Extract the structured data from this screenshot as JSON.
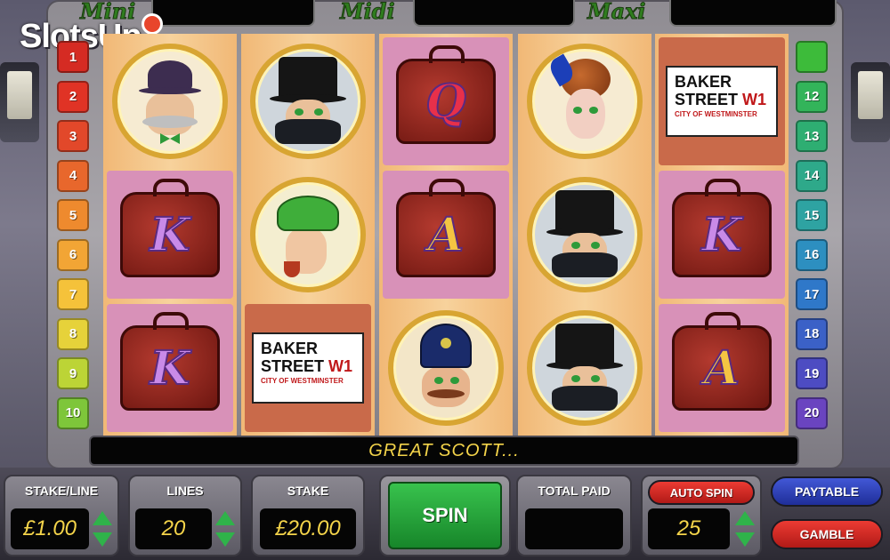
{
  "jackpots": [
    {
      "label": "Mini",
      "value": ""
    },
    {
      "label": "Midi",
      "value": ""
    },
    {
      "label": "Maxi",
      "value": ""
    }
  ],
  "logo": {
    "text_a": "Slots",
    "text_b": "Up"
  },
  "paylines": {
    "left": [
      {
        "n": "1",
        "color": "#d52b23"
      },
      {
        "n": "2",
        "color": "#e03325"
      },
      {
        "n": "3",
        "color": "#e2482a"
      },
      {
        "n": "4",
        "color": "#e8672c"
      },
      {
        "n": "5",
        "color": "#ee8a2e"
      },
      {
        "n": "6",
        "color": "#f2a535"
      },
      {
        "n": "7",
        "color": "#f5c23a"
      },
      {
        "n": "8",
        "color": "#e6d23a"
      },
      {
        "n": "9",
        "color": "#bcd436"
      },
      {
        "n": "10",
        "color": "#7ec63a"
      }
    ],
    "right": [
      {
        "n": "",
        "color": "#3dbb3a"
      },
      {
        "n": "12",
        "color": "#33b45a"
      },
      {
        "n": "13",
        "color": "#2eae72"
      },
      {
        "n": "14",
        "color": "#2ea98a"
      },
      {
        "n": "15",
        "color": "#2ea3a2"
      },
      {
        "n": "16",
        "color": "#2d8fc0"
      },
      {
        "n": "17",
        "color": "#2f78c9"
      },
      {
        "n": "18",
        "color": "#3b61c7"
      },
      {
        "n": "19",
        "color": "#4d4cc2"
      },
      {
        "n": "20",
        "color": "#6a44c0"
      }
    ]
  },
  "reels": [
    [
      "detective-old",
      "bag-k",
      "bag-k"
    ],
    [
      "villain",
      "sherlock",
      "sign"
    ],
    [
      "bag-q",
      "bag-a",
      "policeman"
    ],
    [
      "lady",
      "villain",
      "villain"
    ],
    [
      "sign",
      "bag-k",
      "bag-a"
    ]
  ],
  "sign": {
    "line1": "BAKER",
    "line2": "STREET",
    "w1": "W1",
    "sub": "CITY OF WESTMINSTER"
  },
  "bag_letters": {
    "bag-k": "K",
    "bag-a": "A",
    "bag-q": "Q"
  },
  "message": "GREAT SCOTT...",
  "controls": {
    "stake_line": {
      "label": "STAKE/LINE",
      "value": "£1.00"
    },
    "lines": {
      "label": "LINES",
      "value": "20"
    },
    "stake": {
      "label": "STAKE",
      "value": "£20.00"
    },
    "spin": {
      "label": "SPIN"
    },
    "total_paid": {
      "label": "TOTAL PAID",
      "value": ""
    },
    "auto_spin": {
      "label": "AUTO SPIN",
      "value": "25"
    },
    "paytable": {
      "label": "PAYTABLE"
    },
    "gamble": {
      "label": "GAMBLE"
    }
  },
  "colors": {
    "display_text": "#f4d44a",
    "spin_green": "#2fb34a",
    "auto_red": "#d62a2a",
    "paytable_blue": "#2c3fb8"
  }
}
